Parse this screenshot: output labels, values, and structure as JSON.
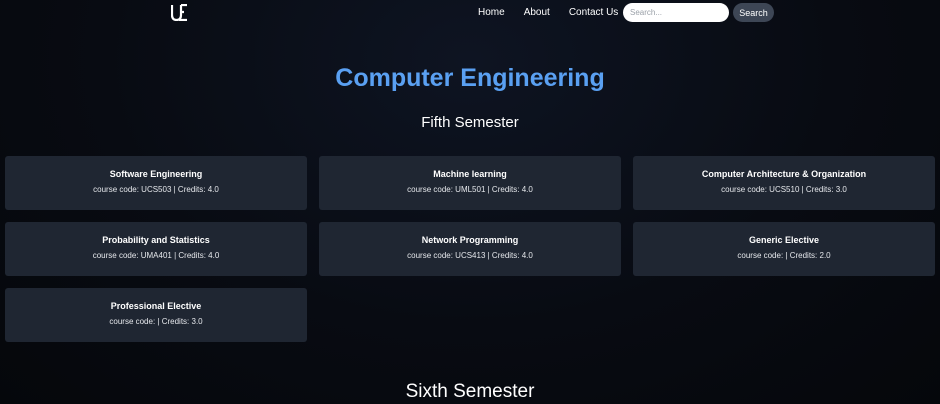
{
  "nav": {
    "logo_text": "UE",
    "links": [
      "Home",
      "About",
      "Contact Us"
    ],
    "search_placeholder": "Search...",
    "search_button": "Search"
  },
  "page": {
    "title": "Computer Engineering",
    "title_color": "#5aa0f2"
  },
  "semesters": [
    {
      "title": "Fifth Semester",
      "courses": [
        {
          "name": "Software Engineering",
          "info": "course code: UCS503 | Credits: 4.0"
        },
        {
          "name": "Machine learning",
          "info": "course code: UML501 | Credits: 4.0"
        },
        {
          "name": "Computer Architecture & Organization",
          "info": "course code: UCS510 | Credits: 3.0"
        },
        {
          "name": "Probability and Statistics",
          "info": "course code: UMA401 | Credits: 4.0"
        },
        {
          "name": "Network Programming",
          "info": "course code: UCS413 | Credits: 4.0"
        },
        {
          "name": "Generic Elective",
          "info": "course code: | Credits: 2.0"
        },
        {
          "name": "Professional Elective",
          "info": "course code: | Credits: 3.0"
        }
      ]
    },
    {
      "title": "Sixth Semester",
      "courses": []
    }
  ]
}
